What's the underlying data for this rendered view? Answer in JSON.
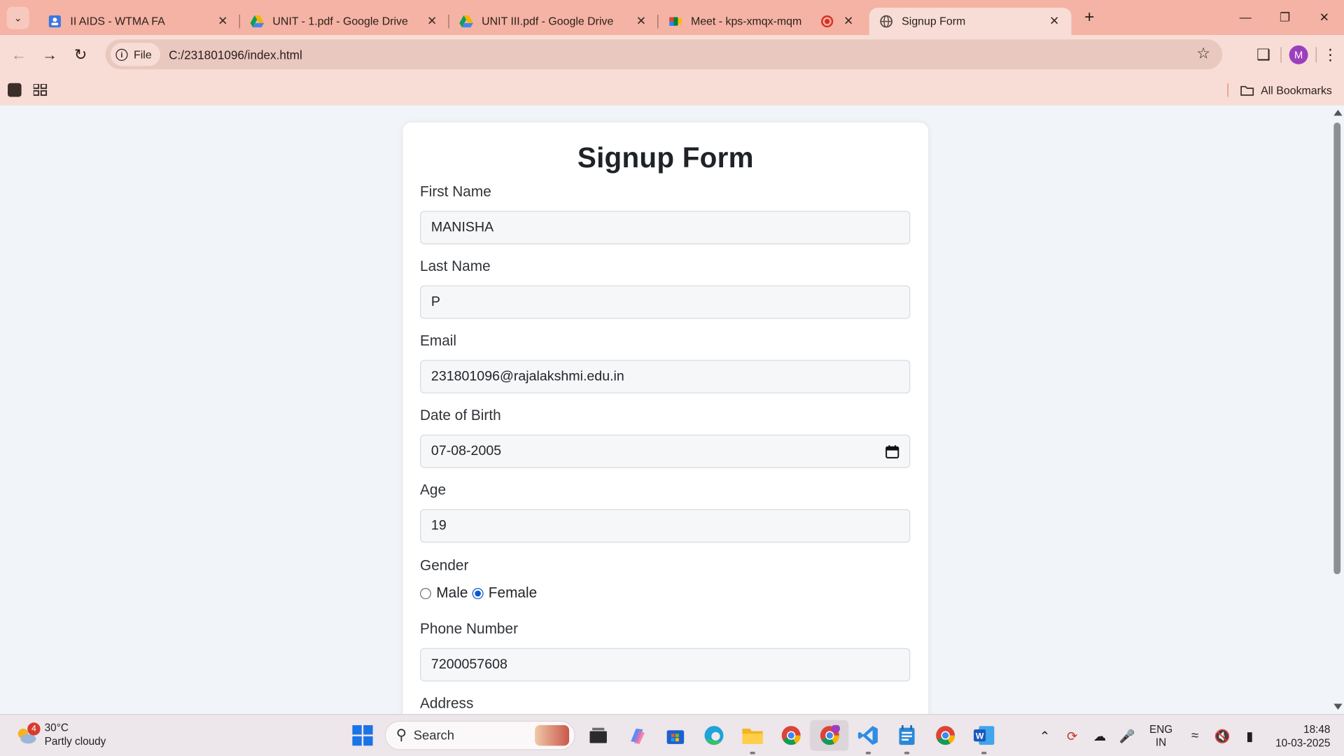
{
  "browser": {
    "tabs": [
      {
        "title": "II AIDS - WTMA FA",
        "icon": "classroom-icon"
      },
      {
        "title": "UNIT - 1.pdf - Google Drive",
        "icon": "google-drive-icon"
      },
      {
        "title": "UNIT III.pdf - Google Drive",
        "icon": "google-drive-icon"
      },
      {
        "title": "Meet - kps-xmqx-mqm",
        "icon": "google-meet-icon",
        "recording": true
      },
      {
        "title": "Signup Form",
        "icon": "globe-icon",
        "active": true
      }
    ],
    "address": {
      "chip_label": "File",
      "url": "C:/231801096/index.html"
    },
    "profile_initial": "M",
    "bookmarks_label": "All Bookmarks",
    "colors": {
      "frame": "#f4b3a4",
      "toolbar": "#f7ddd6",
      "profile": "#9c3fbf"
    }
  },
  "form": {
    "title": "Signup Form",
    "first_name": {
      "label": "First Name",
      "value": "MANISHA"
    },
    "last_name": {
      "label": "Last Name",
      "value": "P"
    },
    "email": {
      "label": "Email",
      "value": "231801096@rajalakshmi.edu.in"
    },
    "dob": {
      "label": "Date of Birth",
      "value": "07-08-2005"
    },
    "age": {
      "label": "Age",
      "value": "19"
    },
    "gender": {
      "label": "Gender",
      "options": [
        "Male",
        "Female"
      ],
      "selected": "Female"
    },
    "phone": {
      "label": "Phone Number",
      "value": "7200057608"
    },
    "address": {
      "label": "Address"
    }
  },
  "taskbar": {
    "weather": {
      "temp": "30°C",
      "condition": "Partly cloudy",
      "alerts": "4"
    },
    "search_placeholder": "Search",
    "tray": {
      "lang": "ENG",
      "region": "IN",
      "time": "18:48",
      "date": "10-03-2025"
    }
  }
}
